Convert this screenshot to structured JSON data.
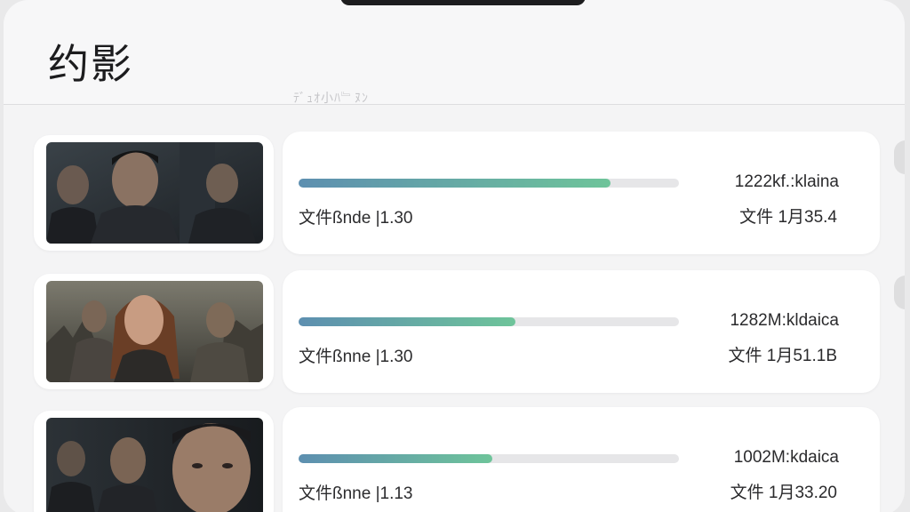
{
  "app": {
    "title": "约影",
    "ghost_text": "ﾃﾞｭｵ小ﾊ﹄ﾇﾝ"
  },
  "items": [
    {
      "thumbnail": "movie-poster-thriller-men",
      "progress": 0.82,
      "size": "1222kf.:klaina",
      "file_info": "文件ßnde |1.30",
      "date": "文件 1月35.4"
    },
    {
      "thumbnail": "movie-poster-woman-city-ruins",
      "progress": 0.57,
      "size": "1282M:kldaica",
      "file_info": "文件ßnne |1.30",
      "date": "文件 1月51.1B"
    },
    {
      "thumbnail": "movie-poster-close-up-men",
      "progress": 0.51,
      "size": "1002M:kdaica",
      "file_info": "文件ßnne |1.13",
      "date": "文件 1月33.20"
    }
  ]
}
